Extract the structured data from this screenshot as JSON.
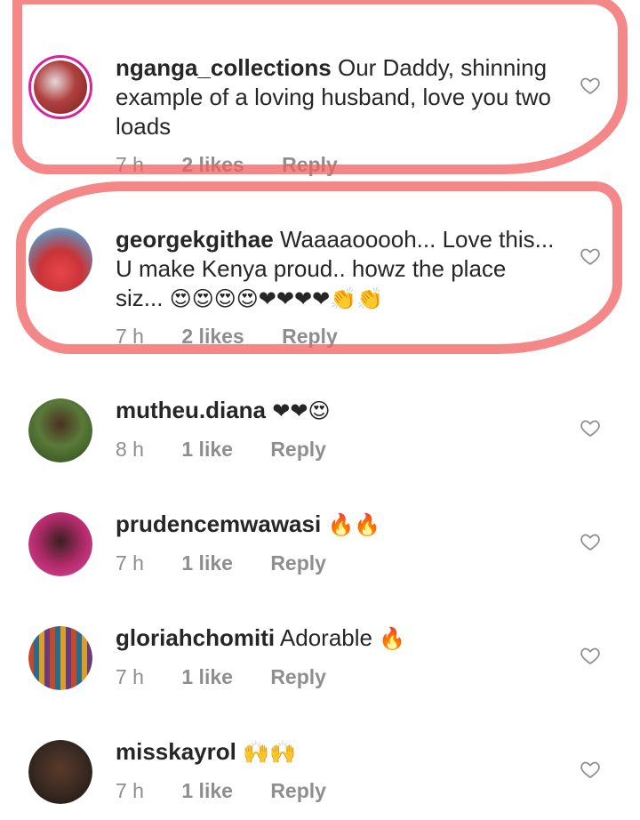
{
  "comments": [
    {
      "username": "nganga_collections",
      "text": "Our Daddy, shinning example of a loving husband, love you two loads",
      "time": "7 h",
      "likes": "2 likes",
      "reply": "Reply",
      "avatar_color": "#8b2a2a"
    },
    {
      "username": "georgekgithae",
      "text": "Waaaaooooh... Love this... U make Kenya proud.. howz the place siz...",
      "emojis": "😍😍😍😍❤❤❤❤👏👏",
      "time": "7 h",
      "likes": "2 likes",
      "reply": "Reply",
      "avatar_color": "#e8444a"
    },
    {
      "username": "mutheu.diana",
      "text": "",
      "emojis": "❤❤😍",
      "time": "8 h",
      "likes": "1 like",
      "reply": "Reply",
      "avatar_color": "#3a6a2a"
    },
    {
      "username": "prudencemwawasi",
      "text": "",
      "emojis": "🔥🔥",
      "time": "7 h",
      "likes": "1 like",
      "reply": "Reply",
      "avatar_color": "#c42a7a"
    },
    {
      "username": "gloriahchomiti",
      "text": "Adorable",
      "emojis": "🔥",
      "time": "7 h",
      "likes": "1 like",
      "reply": "Reply",
      "avatar_color": "#6a4a3a"
    },
    {
      "username": "misskayrol",
      "text": "",
      "emojis": "🙌🙌",
      "time": "7 h",
      "likes": "1 like",
      "reply": "Reply",
      "avatar_color": "#3a2a22"
    }
  ],
  "highlight_color": "#f05f5f",
  "icons": {
    "like": "heart-outline-icon"
  }
}
